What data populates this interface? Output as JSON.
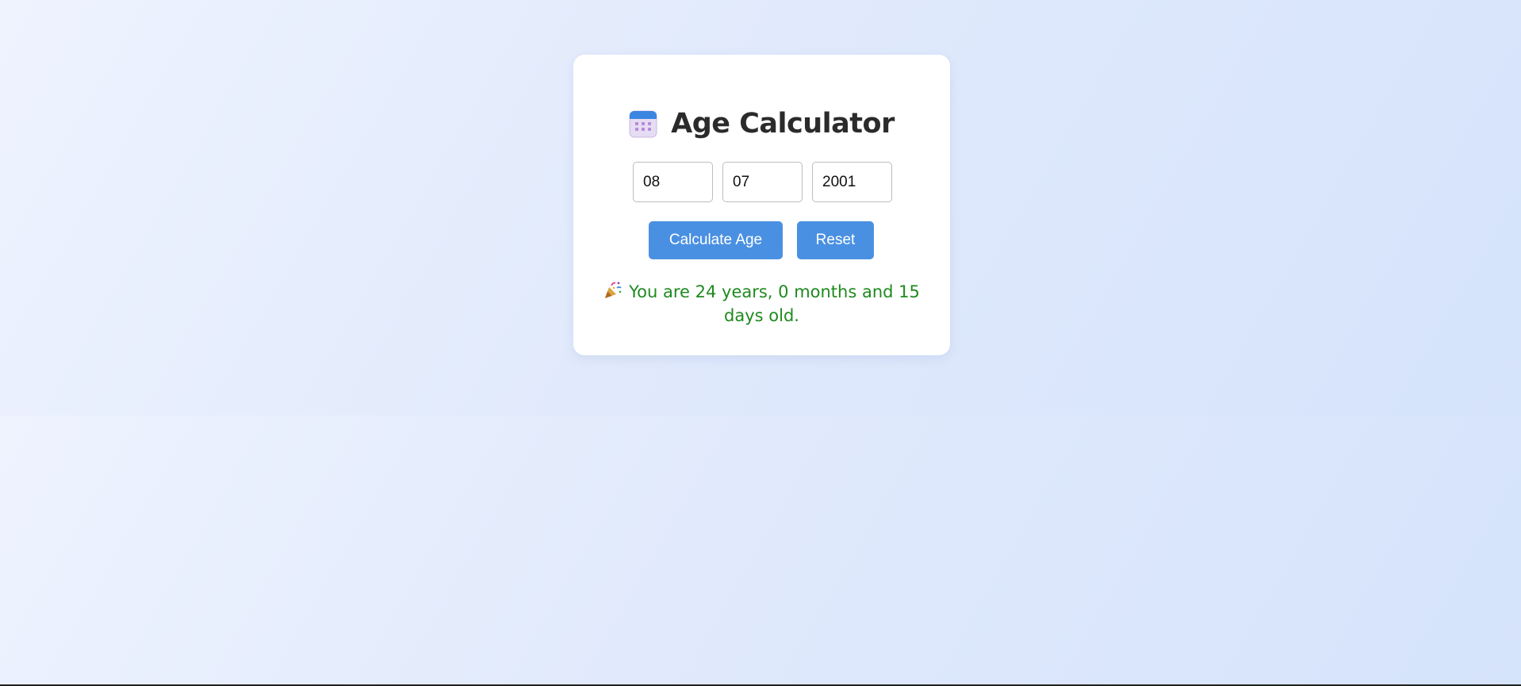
{
  "app": {
    "title": "Age Calculator",
    "title_icon": "calendar-icon"
  },
  "inputs": {
    "day": {
      "value": "08"
    },
    "month": {
      "value": "07"
    },
    "year": {
      "value": "2001"
    }
  },
  "buttons": {
    "calculate_label": "Calculate Age",
    "reset_label": "Reset"
  },
  "result": {
    "icon": "party-popper-icon",
    "text": "You are 24 years, 0 months and 15 days old."
  },
  "colors": {
    "accent": "#4a90e2",
    "result_text": "#1f8a1f",
    "title_text": "#2b2b2b"
  }
}
